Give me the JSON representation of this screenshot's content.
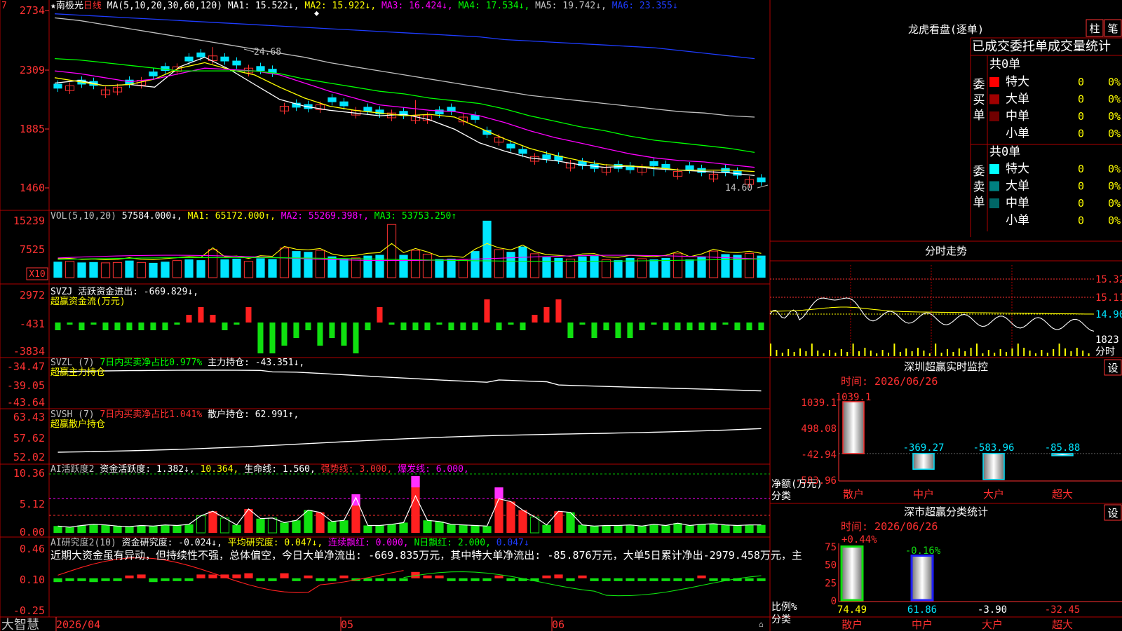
{
  "app": {
    "brand": "大智慧"
  },
  "colors": {
    "up": "#ff3232",
    "down": "#00e5ff",
    "border": "#c00000",
    "ma1": "#ffffff",
    "ma2": "#ffff00",
    "ma3": "#ff00ff",
    "ma4": "#00ff00",
    "ma5": "#c0c0c0",
    "ma6": "#1e3cff",
    "label_gray": "#c0c0c0"
  },
  "main": {
    "title": "★南极光",
    "period": "日线",
    "ma_params": "MA(5,10,20,30,60,120)",
    "ma1": "MA1: 15.522↓,",
    "ma2": "MA2: 15.922↓,",
    "ma3": "MA3: 16.424↓,",
    "ma4": "MA4: 17.534↓,",
    "ma5": "MA5: 19.742↓,",
    "ma6": "MA6: 23.355↓",
    "yticks": [
      "2734",
      "2309",
      "1885",
      "1460"
    ],
    "high_label": "24.68",
    "low_label": "14.60"
  },
  "vol": {
    "params": "VOL(5,10,20)",
    "value": "57584.000↓,",
    "ma1": "MA1: 65172.000↑,",
    "ma2": "MA2: 55269.398↑,",
    "ma3": "MA3: 53753.250↑",
    "yticks": [
      "15239",
      "7525"
    ],
    "unit": "X10"
  },
  "svzj": {
    "line1": "SVZJ  活跃资金进出: -669.829↓,",
    "line2": "超赢资金流(万元)",
    "yticks": [
      "2972",
      "-431",
      "-3834"
    ]
  },
  "svzl": {
    "name": "SVZL (7)",
    "ratio": "7日内买卖净占比0.977%",
    "value": "主力持仓: -43.351↓,",
    "line2": "超赢主力持仓",
    "yticks": [
      "-34.47",
      "-39.05",
      "-43.64"
    ]
  },
  "svsh": {
    "name": "SVSH (7)",
    "ratio": "7日内买卖净占比1.041%",
    "value": "散户持仓: 62.991↑,",
    "line2": "超赢散户持仓",
    "yticks": [
      "63.43",
      "57.62",
      "52.02"
    ]
  },
  "ai1": {
    "name": "AI活跃度2",
    "v1": "资金活跃度: 1.382↓,",
    "v2": "10.364,",
    "v3": "生命线: 1.560,",
    "v4": "强势线: 3.000,",
    "v5": "爆发线: 6.000,",
    "yticks": [
      "10.36",
      "5.12",
      "0.00"
    ]
  },
  "ai2": {
    "name": "AI研究度2(10)",
    "v1": "资金研究度: -0.024↓,",
    "v2": "平均研究度: 0.047↓,",
    "v3": "连续飘红: 0.000,",
    "v4": "N日飘红: 2.000,",
    "v5": "0.047↓",
    "commentary": "近期大资金虽有异动，但持续性不强，总体偏空，今日大单净流出: -669.835万元，其中特大单净流出: -85.876万元，大单5日累计净出-2979.458万元，主",
    "yticks": [
      "0.46",
      "0.10",
      "-0.25"
    ]
  },
  "xaxis": {
    "labels": [
      "2026/04",
      "05",
      "06"
    ]
  },
  "right": {
    "dragon": {
      "title": "龙虎看盘(逐单)",
      "btn1": "柱",
      "btn2": "笔",
      "header": "已成交委托单成交量统计",
      "buy_label": "委买单",
      "sell_label": "委卖单",
      "buy_total": "共0单",
      "sell_total": "共0单",
      "buy_rows": [
        {
          "name": "特大",
          "count": "0",
          "pct": "0%",
          "color": "#ff0000"
        },
        {
          "name": "大单",
          "count": "0",
          "pct": "0%",
          "color": "#a00000"
        },
        {
          "name": "中单",
          "count": "0",
          "pct": "0%",
          "color": "#700000"
        },
        {
          "name": "小单",
          "count": "0",
          "pct": "0%",
          "color": "#000000"
        }
      ],
      "sell_rows": [
        {
          "name": "特大",
          "count": "0",
          "pct": "0%",
          "color": "#00ffff"
        },
        {
          "name": "大单",
          "count": "0",
          "pct": "0%",
          "color": "#008080"
        },
        {
          "name": "中单",
          "count": "0",
          "pct": "0%",
          "color": "#006666"
        },
        {
          "name": "小单",
          "count": "0",
          "pct": "0%",
          "color": "#000000"
        }
      ]
    },
    "fenshi": {
      "title": "分时走势",
      "yticks": [
        "15.32",
        "15.11",
        "14.90"
      ],
      "vol_label": "1823",
      "vol_unit": "分时"
    },
    "monitor": {
      "title": "深圳超赢实时监控",
      "btn": "设",
      "time": "时间: 2026/06/26",
      "yticks": [
        "1039.1",
        "498.08",
        "-42.94",
        "-583.96"
      ],
      "ylabel1": "净额(万元)",
      "ylabel2": "分类",
      "bars": [
        {
          "cat": "散户",
          "value": 1039.1,
          "label": "1039.1"
        },
        {
          "cat": "中户",
          "value": -369.27,
          "label": "-369.27"
        },
        {
          "cat": "大户",
          "value": -583.96,
          "label": "-583.96"
        },
        {
          "cat": "超大",
          "value": -85.88,
          "label": "-85.88"
        }
      ]
    },
    "classify": {
      "title": "深市超赢分类统计",
      "btn": "设",
      "time": "时间: 2026/06/26",
      "yticks": [
        "75",
        "50",
        "25",
        "0"
      ],
      "ylabel1": "比例%",
      "ylabel2": "分类",
      "bars": [
        {
          "cat": "散户",
          "value": 74.49,
          "top_label": "+0.44%",
          "bottom_label": "74.49"
        },
        {
          "cat": "中户",
          "value": 61.86,
          "top_label": "-0.16%",
          "bottom_label": "61.86"
        },
        {
          "cat": "大户",
          "value": -3.9,
          "top_label": "",
          "bottom_label": "-3.90"
        },
        {
          "cat": "超大",
          "value": -32.45,
          "top_label": "",
          "bottom_label": "-32.45"
        }
      ]
    }
  },
  "chart_data": [
    {
      "type": "candlestick",
      "name": "日线",
      "ylim": [
        14.6,
        24.68
      ],
      "note_high": 24.68,
      "note_low": 14.6,
      "open": [],
      "high": [],
      "low": [],
      "close": []
    },
    {
      "type": "bar",
      "name": "VOL",
      "values": []
    },
    {
      "type": "bar",
      "name": "超赢资金流",
      "values": []
    },
    {
      "type": "line",
      "name": "主力持仓",
      "values": []
    },
    {
      "type": "line",
      "name": "散户持仓",
      "values": []
    },
    {
      "type": "bar",
      "name": "资金活跃度",
      "values": []
    },
    {
      "type": "bar",
      "name": "资金研究度",
      "values": []
    },
    {
      "type": "bar",
      "name": "深圳超赢实时监控",
      "categories": [
        "散户",
        "中户",
        "大户",
        "超大"
      ],
      "values": [
        1039.1,
        -369.27,
        -583.96,
        -85.88
      ]
    },
    {
      "type": "bar",
      "name": "深市超赢分类统计",
      "categories": [
        "散户",
        "中户",
        "大户",
        "超大"
      ],
      "values": [
        74.49,
        61.86,
        -3.9,
        -32.45
      ]
    }
  ]
}
